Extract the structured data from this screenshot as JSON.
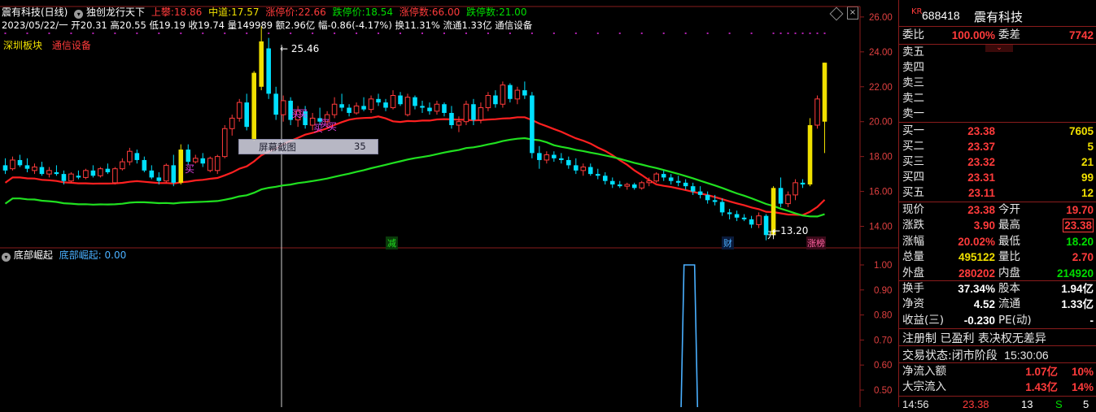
{
  "header": {
    "stock_title": "震有科技(日线)",
    "formula_name": "独创龙行天下",
    "shangzhan_label": "上攀:",
    "shangzhan_value": "18.86",
    "zhongdao_label": "中道:",
    "zhongdao_value": "17.57",
    "zhangtingjia_label": "涨停价:",
    "zhangtingjia_value": "22.66",
    "dietingjia_label": "跌停价:",
    "dietingjia_value": "18.54",
    "zhangtingshu_label": "涨停数:",
    "zhangtingshu_value": "66.00",
    "dietingshu_label": "跌停数:",
    "dietingshu_value": "21.00",
    "bar_info": "2023/05/22/一 开20.31 高20.55 低19.19 收19.74 量149989 额2.96亿 幅-0.86(-4.17%) 换11.31% 流通1.33亿 通信设备",
    "tag_board": "深圳板块",
    "tag_industry": "通信设备"
  },
  "chart_labels": {
    "peak_label": "25.46",
    "low_label": "13.20",
    "buy_marks": [
      "买",
      "买",
      "买",
      "买",
      "买",
      "买"
    ],
    "event_jian": "减",
    "event_cai": "财",
    "event_zhangbang": "涨榜",
    "event_kai": "开",
    "screenshot_tip": "屏幕截图",
    "screenshot_num": "35"
  },
  "main_axis": [
    "26.00",
    "24.00",
    "22.00",
    "20.00",
    "18.00",
    "16.00",
    "14.00"
  ],
  "indicator": {
    "name": "底部崛起",
    "series_label": "底部崛起: 0.00",
    "axis": [
      "1.00",
      "0.90",
      "0.80",
      "0.70",
      "0.60",
      "0.50"
    ]
  },
  "chart_data": {
    "type": "candlestick",
    "ylim": [
      13.0,
      26.6
    ],
    "ma_red_name": "",
    "ma_green_name": "",
    "candles": [
      {
        "o": 17.5,
        "h": 17.9,
        "l": 17.0,
        "c": 17.2
      },
      {
        "o": 17.3,
        "h": 18.0,
        "l": 17.2,
        "c": 17.8
      },
      {
        "o": 17.8,
        "h": 18.1,
        "l": 17.4,
        "c": 17.5
      },
      {
        "o": 17.5,
        "h": 17.9,
        "l": 17.1,
        "c": 17.3
      },
      {
        "o": 17.2,
        "h": 17.6,
        "l": 17.0,
        "c": 17.4
      },
      {
        "o": 17.4,
        "h": 17.7,
        "l": 16.9,
        "c": 17.0
      },
      {
        "o": 17.0,
        "h": 17.4,
        "l": 16.8,
        "c": 17.2
      },
      {
        "o": 17.1,
        "h": 17.5,
        "l": 16.9,
        "c": 17.0
      },
      {
        "o": 17.0,
        "h": 17.2,
        "l": 16.4,
        "c": 16.6
      },
      {
        "o": 16.6,
        "h": 17.1,
        "l": 16.5,
        "c": 17.0
      },
      {
        "o": 16.9,
        "h": 17.2,
        "l": 16.7,
        "c": 16.8
      },
      {
        "o": 16.8,
        "h": 17.3,
        "l": 16.7,
        "c": 17.2
      },
      {
        "o": 17.2,
        "h": 17.5,
        "l": 16.8,
        "c": 16.9
      },
      {
        "o": 16.9,
        "h": 17.4,
        "l": 16.8,
        "c": 17.3
      },
      {
        "o": 17.3,
        "h": 17.6,
        "l": 17.0,
        "c": 17.1
      },
      {
        "o": 16.5,
        "h": 17.4,
        "l": 16.4,
        "c": 17.3
      },
      {
        "o": 17.3,
        "h": 17.9,
        "l": 17.2,
        "c": 17.7
      },
      {
        "o": 17.7,
        "h": 18.5,
        "l": 17.5,
        "c": 18.3
      },
      {
        "o": 18.2,
        "h": 18.4,
        "l": 17.6,
        "c": 17.8
      },
      {
        "o": 17.8,
        "h": 18.0,
        "l": 17.1,
        "c": 17.2
      },
      {
        "o": 17.2,
        "h": 17.5,
        "l": 16.7,
        "c": 16.8
      },
      {
        "o": 16.8,
        "h": 17.1,
        "l": 16.4,
        "c": 16.6
      },
      {
        "o": 16.6,
        "h": 17.6,
        "l": 16.5,
        "c": 17.5
      },
      {
        "o": 17.5,
        "h": 18.1,
        "l": 16.3,
        "c": 16.5
      },
      {
        "o": 16.5,
        "h": 18.7,
        "l": 16.4,
        "c": 18.4
      },
      {
        "o": 18.4,
        "h": 18.7,
        "l": 17.5,
        "c": 17.7
      },
      {
        "o": 17.7,
        "h": 18.1,
        "l": 17.6,
        "c": 17.9
      },
      {
        "o": 17.9,
        "h": 18.2,
        "l": 17.4,
        "c": 17.6
      },
      {
        "o": 17.2,
        "h": 18.0,
        "l": 17.1,
        "c": 17.9
      },
      {
        "o": 17.2,
        "h": 18.1,
        "l": 17.0,
        "c": 18.0
      },
      {
        "o": 18.0,
        "h": 19.8,
        "l": 17.9,
        "c": 19.6
      },
      {
        "o": 19.6,
        "h": 20.4,
        "l": 19.2,
        "c": 20.2
      },
      {
        "o": 20.2,
        "h": 21.3,
        "l": 20.0,
        "c": 21.1
      },
      {
        "o": 21.1,
        "h": 21.6,
        "l": 19.5,
        "c": 19.7
      },
      {
        "o": 19.0,
        "h": 22.9,
        "l": 18.9,
        "c": 22.8
      },
      {
        "o": 22.0,
        "h": 25.46,
        "l": 21.8,
        "c": 24.6
      },
      {
        "o": 24.2,
        "h": 24.8,
        "l": 21.3,
        "c": 21.6
      },
      {
        "o": 21.6,
        "h": 22.0,
        "l": 20.1,
        "c": 20.4
      },
      {
        "o": 20.4,
        "h": 21.5,
        "l": 20.0,
        "c": 21.2
      },
      {
        "o": 21.2,
        "h": 21.4,
        "l": 19.8,
        "c": 20.1
      },
      {
        "o": 20.1,
        "h": 20.9,
        "l": 19.7,
        "c": 20.6
      },
      {
        "o": 20.6,
        "h": 20.9,
        "l": 19.6,
        "c": 19.8
      },
      {
        "o": 19.8,
        "h": 20.5,
        "l": 19.5,
        "c": 20.2
      },
      {
        "o": 20.2,
        "h": 20.8,
        "l": 19.8,
        "c": 20.0
      },
      {
        "o": 20.0,
        "h": 20.6,
        "l": 19.6,
        "c": 20.4
      },
      {
        "o": 20.4,
        "h": 21.4,
        "l": 20.2,
        "c": 21.0
      },
      {
        "o": 21.0,
        "h": 21.6,
        "l": 20.6,
        "c": 20.8
      },
      {
        "o": 20.8,
        "h": 21.0,
        "l": 20.3,
        "c": 20.5
      },
      {
        "o": 20.5,
        "h": 21.1,
        "l": 20.4,
        "c": 20.9
      },
      {
        "o": 20.9,
        "h": 21.4,
        "l": 20.6,
        "c": 20.7
      },
      {
        "o": 20.7,
        "h": 21.5,
        "l": 20.5,
        "c": 21.3
      },
      {
        "o": 21.3,
        "h": 21.6,
        "l": 20.9,
        "c": 21.1
      },
      {
        "o": 21.1,
        "h": 21.3,
        "l": 20.6,
        "c": 20.8
      },
      {
        "o": 20.8,
        "h": 21.8,
        "l": 20.7,
        "c": 21.5
      },
      {
        "o": 21.5,
        "h": 21.7,
        "l": 20.9,
        "c": 21.0
      },
      {
        "o": 20.4,
        "h": 21.6,
        "l": 20.3,
        "c": 21.4
      },
      {
        "o": 21.4,
        "h": 21.5,
        "l": 20.7,
        "c": 20.9
      },
      {
        "o": 20.9,
        "h": 21.2,
        "l": 20.5,
        "c": 20.8
      },
      {
        "o": 20.8,
        "h": 21.1,
        "l": 20.4,
        "c": 20.6
      },
      {
        "o": 20.6,
        "h": 21.2,
        "l": 20.4,
        "c": 21.0
      },
      {
        "o": 21.0,
        "h": 21.1,
        "l": 20.3,
        "c": 20.5
      },
      {
        "o": 20.5,
        "h": 20.9,
        "l": 19.6,
        "c": 19.8
      },
      {
        "o": 19.8,
        "h": 20.3,
        "l": 19.4,
        "c": 20.0
      },
      {
        "o": 20.0,
        "h": 21.2,
        "l": 19.8,
        "c": 21.0
      },
      {
        "o": 21.0,
        "h": 21.3,
        "l": 19.8,
        "c": 20.1
      },
      {
        "o": 20.1,
        "h": 21.1,
        "l": 19.9,
        "c": 20.8
      },
      {
        "o": 20.8,
        "h": 21.7,
        "l": 20.6,
        "c": 21.5
      },
      {
        "o": 21.5,
        "h": 21.8,
        "l": 20.8,
        "c": 21.0
      },
      {
        "o": 21.0,
        "h": 22.3,
        "l": 20.8,
        "c": 22.1
      },
      {
        "o": 22.1,
        "h": 22.2,
        "l": 21.1,
        "c": 21.3
      },
      {
        "o": 21.3,
        "h": 22.0,
        "l": 21.0,
        "c": 21.8
      },
      {
        "o": 21.8,
        "h": 22.3,
        "l": 21.3,
        "c": 21.5
      },
      {
        "o": 21.5,
        "h": 21.7,
        "l": 17.9,
        "c": 18.2
      },
      {
        "o": 18.2,
        "h": 18.6,
        "l": 17.3,
        "c": 17.8
      },
      {
        "o": 17.8,
        "h": 18.3,
        "l": 17.6,
        "c": 18.1
      },
      {
        "o": 18.1,
        "h": 18.3,
        "l": 17.7,
        "c": 17.9
      },
      {
        "o": 17.9,
        "h": 18.2,
        "l": 17.6,
        "c": 17.8
      },
      {
        "o": 17.8,
        "h": 18.0,
        "l": 17.3,
        "c": 17.5
      },
      {
        "o": 17.5,
        "h": 17.9,
        "l": 17.0,
        "c": 17.2
      },
      {
        "o": 17.2,
        "h": 17.6,
        "l": 16.9,
        "c": 17.4
      },
      {
        "o": 17.4,
        "h": 17.6,
        "l": 16.9,
        "c": 17.0
      },
      {
        "o": 17.0,
        "h": 17.3,
        "l": 16.7,
        "c": 16.9
      },
      {
        "o": 16.9,
        "h": 17.1,
        "l": 16.4,
        "c": 16.6
      },
      {
        "o": 16.6,
        "h": 16.8,
        "l": 16.2,
        "c": 16.4
      },
      {
        "o": 16.4,
        "h": 16.6,
        "l": 16.2,
        "c": 16.3
      },
      {
        "o": 16.3,
        "h": 16.5,
        "l": 16.1,
        "c": 16.4
      },
      {
        "o": 16.4,
        "h": 16.5,
        "l": 16.1,
        "c": 16.2
      },
      {
        "o": 16.2,
        "h": 16.6,
        "l": 16.1,
        "c": 16.5
      },
      {
        "o": 16.5,
        "h": 16.8,
        "l": 16.3,
        "c": 16.6
      },
      {
        "o": 16.6,
        "h": 17.1,
        "l": 16.5,
        "c": 17.0
      },
      {
        "o": 17.0,
        "h": 17.2,
        "l": 16.6,
        "c": 16.8
      },
      {
        "o": 16.8,
        "h": 17.0,
        "l": 16.4,
        "c": 16.6
      },
      {
        "o": 16.6,
        "h": 16.9,
        "l": 16.3,
        "c": 16.5
      },
      {
        "o": 16.5,
        "h": 16.7,
        "l": 16.1,
        "c": 16.3
      },
      {
        "o": 16.3,
        "h": 16.5,
        "l": 15.8,
        "c": 16.0
      },
      {
        "o": 16.0,
        "h": 16.3,
        "l": 15.6,
        "c": 15.8
      },
      {
        "o": 15.8,
        "h": 16.0,
        "l": 15.3,
        "c": 15.5
      },
      {
        "o": 15.5,
        "h": 15.8,
        "l": 15.2,
        "c": 15.4
      },
      {
        "o": 15.4,
        "h": 15.6,
        "l": 14.6,
        "c": 14.8
      },
      {
        "o": 14.8,
        "h": 15.0,
        "l": 14.4,
        "c": 14.7
      },
      {
        "o": 14.7,
        "h": 14.9,
        "l": 14.3,
        "c": 14.5
      },
      {
        "o": 14.5,
        "h": 14.7,
        "l": 14.3,
        "c": 14.4
      },
      {
        "o": 14.4,
        "h": 14.6,
        "l": 13.9,
        "c": 14.1
      },
      {
        "o": 14.1,
        "h": 14.8,
        "l": 13.9,
        "c": 14.6
      },
      {
        "o": 14.6,
        "h": 14.7,
        "l": 13.2,
        "c": 13.5
      },
      {
        "o": 13.5,
        "h": 16.3,
        "l": 13.4,
        "c": 16.2
      },
      {
        "o": 16.2,
        "h": 16.8,
        "l": 15.1,
        "c": 15.3
      },
      {
        "o": 15.3,
        "h": 16.0,
        "l": 15.1,
        "c": 15.8
      },
      {
        "o": 15.8,
        "h": 16.7,
        "l": 15.5,
        "c": 16.5
      },
      {
        "o": 16.5,
        "h": 16.7,
        "l": 16.2,
        "c": 16.4
      },
      {
        "o": 16.4,
        "h": 20.2,
        "l": 16.3,
        "c": 19.8
      },
      {
        "o": 19.8,
        "h": 21.5,
        "l": 19.6,
        "c": 21.3
      },
      {
        "o": 20.0,
        "h": 23.38,
        "l": 18.2,
        "c": 23.38
      }
    ],
    "indicator_spike": {
      "from_index": 93,
      "to_index": 94,
      "value": 1.0
    }
  },
  "right_panel": {
    "code": "688418",
    "name": "震有科技",
    "kr_tag": "KR",
    "weibi_label": "委比",
    "weibi_value": "100.00%",
    "weicha_label": "委差",
    "weicha_value": "7742",
    "asks": [
      {
        "label": "卖五"
      },
      {
        "label": "卖四"
      },
      {
        "label": "卖三"
      },
      {
        "label": "卖二"
      },
      {
        "label": "卖一"
      }
    ],
    "bids": [
      {
        "label": "买一",
        "price": "23.38",
        "vol": "7605"
      },
      {
        "label": "买二",
        "price": "23.37",
        "vol": "5"
      },
      {
        "label": "买三",
        "price": "23.32",
        "vol": "21"
      },
      {
        "label": "买四",
        "price": "23.31",
        "vol": "99"
      },
      {
        "label": "买五",
        "price": "23.11",
        "vol": "12"
      }
    ],
    "quote_rows": [
      {
        "l1": "现价",
        "v1": "23.38",
        "c1": "red",
        "l2": "今开",
        "v2": "19.70",
        "c2": "red"
      },
      {
        "l1": "涨跌",
        "v1": "3.90",
        "c1": "red",
        "l2": "最高",
        "v2": "23.38",
        "c2": "red"
      },
      {
        "l1": "涨幅",
        "v1": "20.02%",
        "c1": "red",
        "l2": "最低",
        "v2": "18.20",
        "c2": "green"
      },
      {
        "l1": "总量",
        "v1": "495122",
        "c1": "yellow",
        "l2": "量比",
        "v2": "2.70",
        "c2": "red"
      },
      {
        "l1": "外盘",
        "v1": "280202",
        "c1": "red",
        "l2": "内盘",
        "v2": "214920",
        "c2": "green"
      }
    ],
    "stat_rows": [
      {
        "l1": "换手",
        "v1": "37.34%",
        "l2": "股本",
        "v2": "1.94亿"
      },
      {
        "l1": "净资",
        "v1": "4.52",
        "l2": "流通",
        "v2": "1.33亿"
      },
      {
        "l1": "收益(三)",
        "v1": "-0.230",
        "l2": "PE(动)",
        "v2": "-"
      }
    ],
    "reg_note": "注册制 已盈利 表决权无差异",
    "trade_status_label": "交易状态:",
    "trade_status": "闭市阶段",
    "trade_time": "15:30:06",
    "netflow_label": "净流入额",
    "netflow_value": "1.07亿",
    "netflow_pct": "10%",
    "bigflow_label": "大宗流入",
    "bigflow_value": "1.43亿",
    "bigflow_pct": "14%",
    "tick_time": "14:56",
    "tick_price": "23.38",
    "tick_vol": "13",
    "tick_side": "S",
    "tick_count": "5"
  },
  "colors": {
    "up": "#ff3b3b",
    "down": "#00e0ff",
    "limit_up": "#f0e000",
    "ma_red": "#ff2020",
    "ma_green": "#20e020",
    "indicator_line": "#4ab0ff",
    "grid_dot": "#b020b0"
  }
}
